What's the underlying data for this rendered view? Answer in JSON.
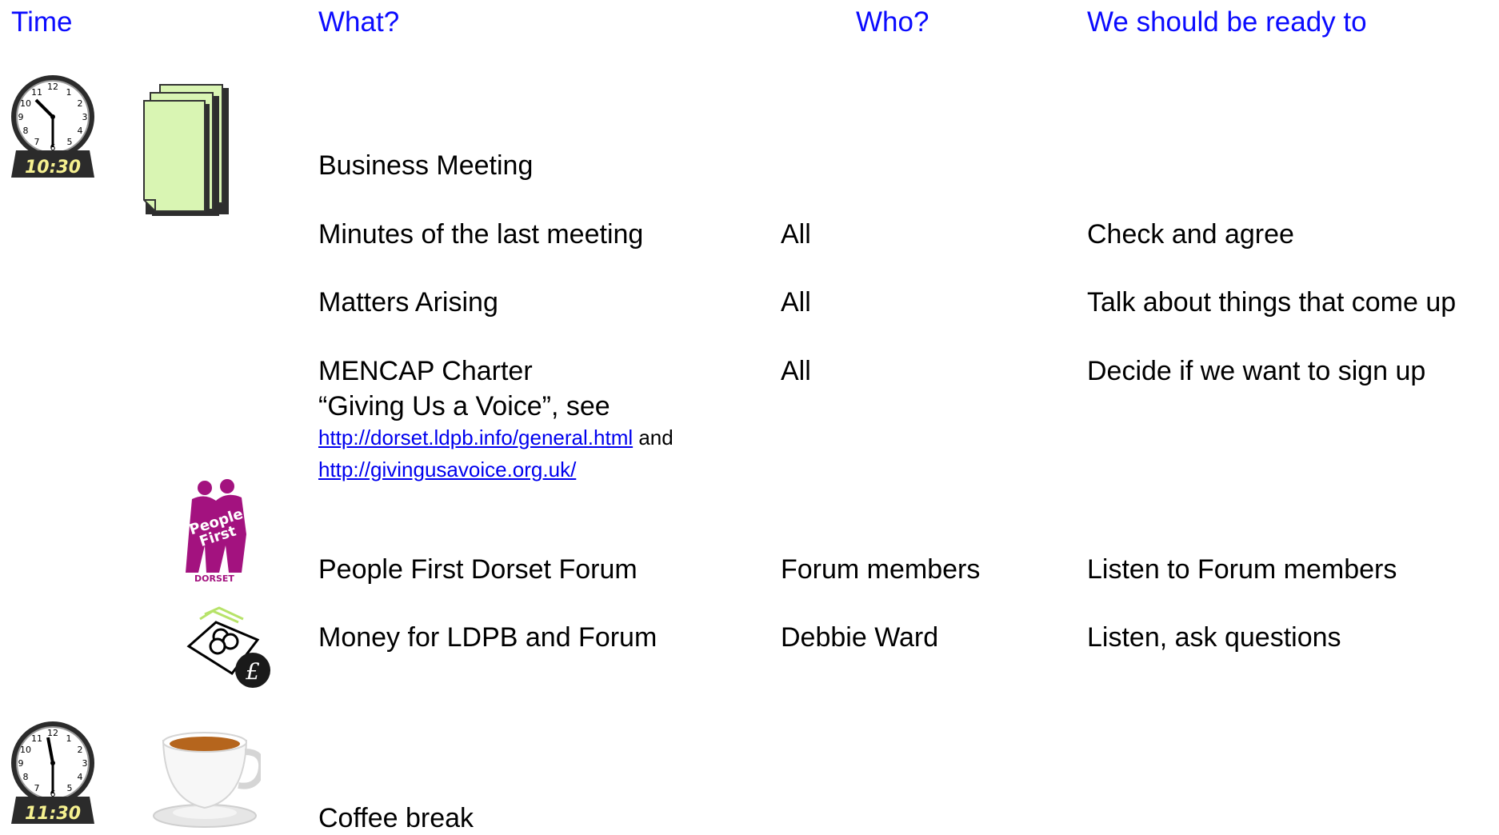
{
  "headers": {
    "time": "Time",
    "what": "What?",
    "who": "Who?",
    "ready": "We should be ready to"
  },
  "clocks": [
    {
      "time_label": "10:30",
      "icon": "clock-icon"
    },
    {
      "time_label": "11:30",
      "icon": "clock-icon"
    }
  ],
  "section": {
    "title": "Business Meeting",
    "icon": "documents-icon"
  },
  "rows": [
    {
      "what": "Minutes of the last meeting",
      "who": "All",
      "ready": "Check and agree"
    },
    {
      "what": "Matters Arising",
      "who": "All",
      "ready": "Talk about things that come up"
    },
    {
      "what_line1": "MENCAP Charter",
      "what_line2": "“Giving Us a Voice”, see",
      "link1": "http://dorset.ldpb.info/general.html",
      "and_text": " and",
      "link2": "http://givingusavoice.org.uk/",
      "who": "All",
      "ready": "Decide if we want to sign up"
    },
    {
      "what": "People First Dorset Forum",
      "who": "Forum members",
      "ready": "Listen to Forum members",
      "logo_text1": "People",
      "logo_text2": "First",
      "logo_text3": "DORSET"
    },
    {
      "what": "Money for LDPB and Forum",
      "who": "Debbie Ward",
      "ready": "Listen, ask questions",
      "icon": "money-icon",
      "symbol": "£"
    }
  ],
  "break": {
    "what": "Coffee break",
    "icon": "coffee-cup-icon"
  },
  "colors": {
    "header": "#0b0bff",
    "link": "#0000ee",
    "logo": "#a3127f",
    "doc_fill": "#d9f5b3"
  }
}
